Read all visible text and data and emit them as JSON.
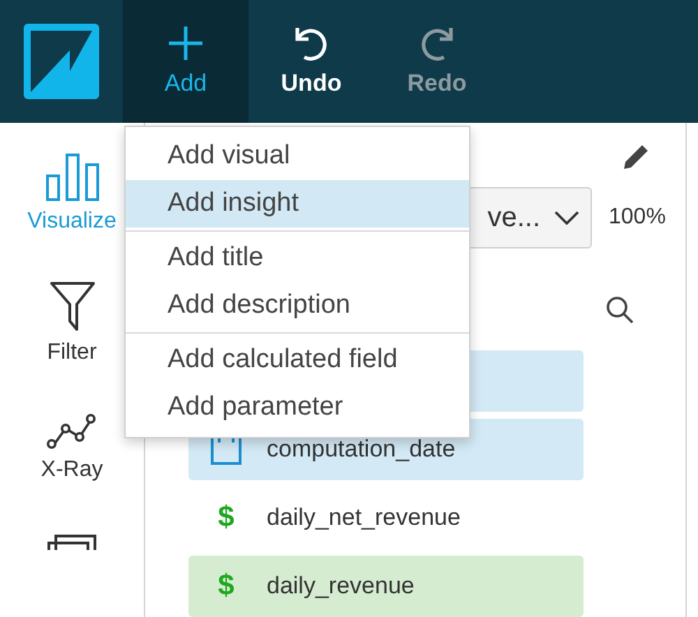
{
  "toolbar": {
    "buttons": [
      {
        "kind": "plus",
        "label": "Add",
        "active": true,
        "disabled": false
      },
      {
        "kind": "undo",
        "label": "Undo",
        "active": false,
        "disabled": false
      },
      {
        "kind": "redo",
        "label": "Redo",
        "active": false,
        "disabled": true
      }
    ]
  },
  "sidebar": {
    "items": [
      {
        "kind": "bars",
        "label": "Visualize",
        "selected": true
      },
      {
        "kind": "filter",
        "label": "Filter",
        "selected": false
      },
      {
        "kind": "xray",
        "label": "X-Ray",
        "selected": false
      },
      {
        "kind": "stack",
        "selected": false
      }
    ]
  },
  "visual_select": {
    "value": "ve..."
  },
  "zoom": "100%",
  "fields": [
    {
      "kind": "dimension",
      "selected": true
    },
    {
      "kind": "date",
      "name": "computation_date",
      "selected": true
    },
    {
      "kind": "measure",
      "symbol": "$",
      "name": "daily_net_revenue",
      "selected": false
    },
    {
      "kind": "measure",
      "symbol": "$",
      "name": "daily_revenue",
      "selected": true
    }
  ],
  "add_menu": {
    "groups": [
      [
        {
          "label": "Add visual",
          "selected": false
        },
        {
          "label": "Add insight",
          "selected": true
        }
      ],
      [
        {
          "label": "Add title",
          "selected": false
        },
        {
          "label": "Add description",
          "selected": false
        }
      ],
      [
        {
          "label": "Add calculated field",
          "selected": false
        },
        {
          "label": "Add parameter",
          "selected": false
        }
      ]
    ]
  }
}
